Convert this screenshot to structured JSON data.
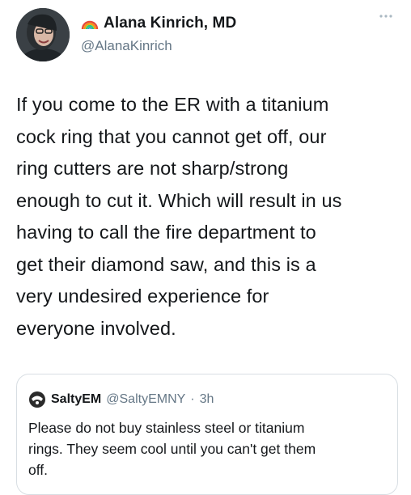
{
  "tweet": {
    "display_name": "Alana Kinrich, MD",
    "handle": "@AlanaKinrich",
    "icons": {
      "avatar": "avatar",
      "badge": "rainbow-icon",
      "more": "more-options-icon"
    },
    "text": "If you come to the ER with a titanium\ncock ring that you cannot get off, our\nring cutters are not sharp/strong\nenough to cut it. Which will result in us\nhaving to call the fire department to\nget their diamond saw, and this is a\nvery undesired experience for\neveryone involved."
  },
  "quoted_tweet": {
    "display_name": "SaltyEM",
    "handle": "@SaltyEMNY",
    "separator": "·",
    "time": "3h",
    "text": "Please do not buy stainless steel or titanium\nrings. They seem cool until you can't get them\noff."
  },
  "colors": {
    "text_primary": "#14171a",
    "text_secondary": "#657786",
    "card_border": "#d8dee3"
  }
}
